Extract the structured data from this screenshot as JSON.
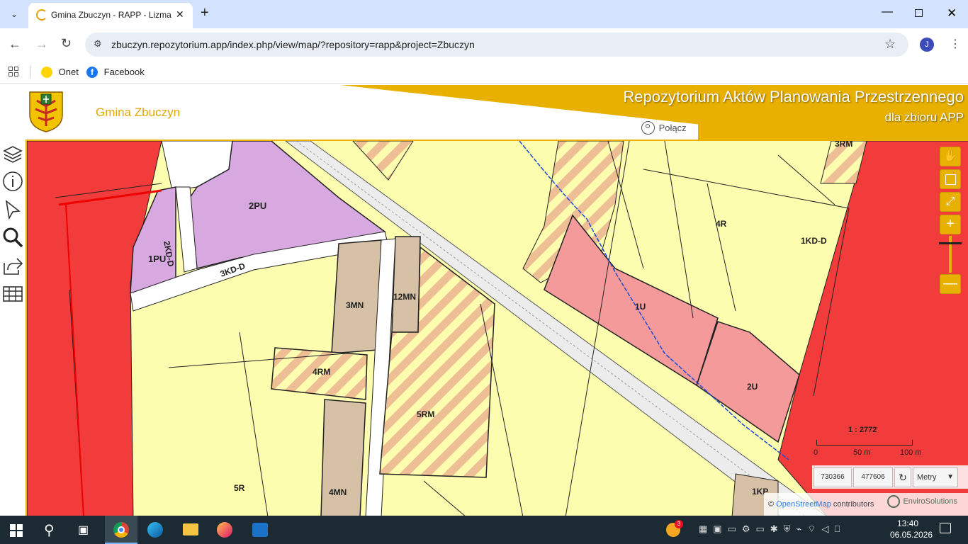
{
  "browser": {
    "tab_title": "Gmina Zbuczyn - RAPP - Lizma",
    "url": "zbuczyn.repozytorium.app/index.php/view/map/?repository=rapp&project=Zbuczyn",
    "profile_initial": "J",
    "bookmarks": [
      "Onet",
      "Facebook"
    ]
  },
  "header": {
    "site_name": "Gmina Zbuczyn",
    "banner_title": "Repozytorium Aktów Planowania Przestrzennego",
    "banner_subtitle": "dla zbioru APP",
    "login_label": "Połącz"
  },
  "map": {
    "labels": [
      "2PU",
      "1PU",
      "2KD-D",
      "3KD-D",
      "3MN",
      "12MN",
      "4RM",
      "5RM",
      "5R",
      "4MN",
      "4R",
      "1KD-D",
      "3RM",
      "1U",
      "2U",
      "1KP"
    ],
    "scale_text": "1 : 2772",
    "scale_ticks": [
      "0",
      "50 m",
      "100 m"
    ],
    "coord_x": "730366",
    "coord_y": "477606",
    "units_select": "Metry",
    "attribution_link": "OpenStreetMap",
    "attribution_suffix": "contributors",
    "attribution_prefix": "©",
    "brand": "EnviroSolutions"
  },
  "taskbar": {
    "time": "13:40",
    "date": "06.05.2026",
    "badge": "3"
  },
  "colors": {
    "accent": "#e8b000",
    "zone_red": "#f23b3b",
    "zone_yellow": "#fdfdb0",
    "zone_purple": "#d7a9e0",
    "zone_pink": "#f59a9a",
    "zone_tan": "#d6c1a6"
  }
}
